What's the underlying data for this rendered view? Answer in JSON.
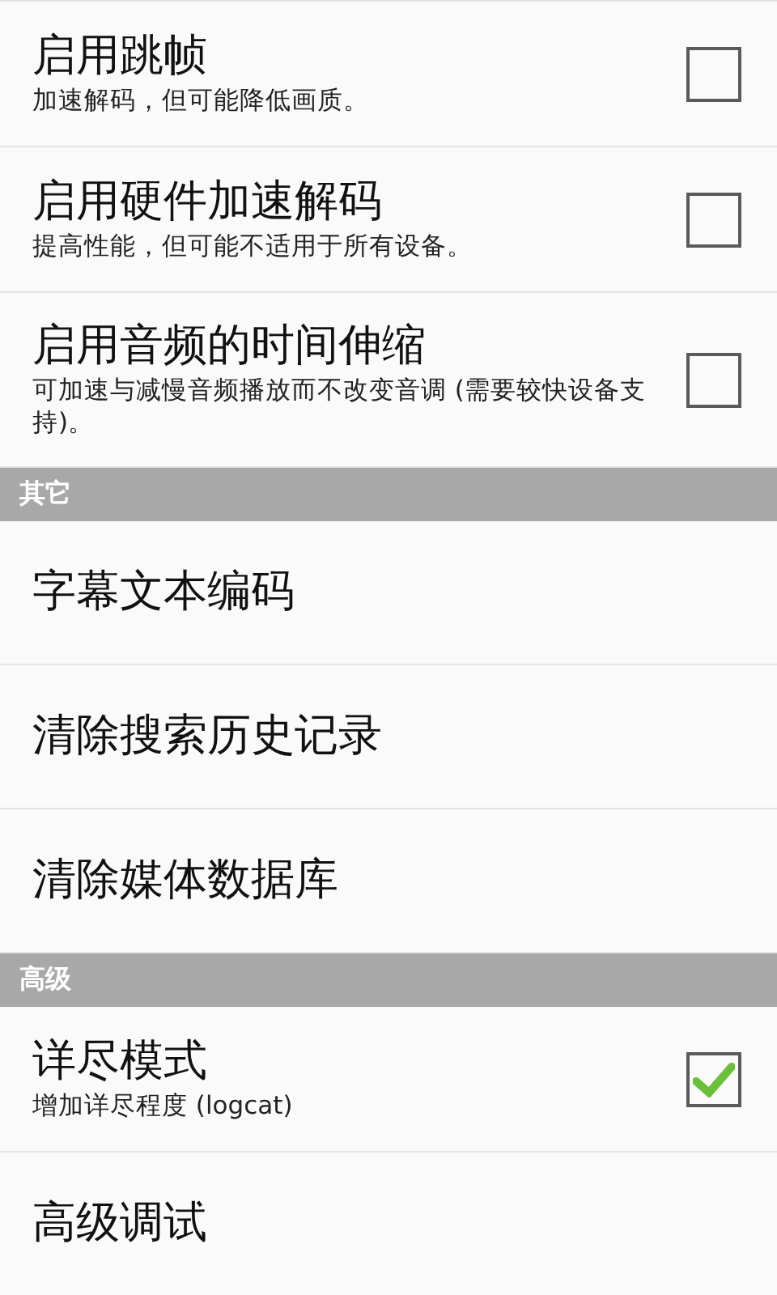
{
  "sections": [
    {
      "kind": "list",
      "items": [
        {
          "title": "启用跳帧",
          "subtitle": "加速解码，但可能降低画质。",
          "checked": false
        },
        {
          "title": "启用硬件加速解码",
          "subtitle": "提高性能，但可能不适用于所有设备。",
          "checked": false
        },
        {
          "title": "启用音频的时间伸缩",
          "subtitle": "可加速与减慢音频播放而不改变音调 (需要较快设备支持)。",
          "checked": false
        }
      ]
    },
    {
      "kind": "group",
      "header": "其它",
      "items": [
        {
          "title": "字幕文本编码"
        },
        {
          "title": "清除搜索历史记录"
        },
        {
          "title": "清除媒体数据库"
        }
      ]
    },
    {
      "kind": "group",
      "header": "高级",
      "items": [
        {
          "title": "详尽模式",
          "subtitle": "增加详尽程度 (logcat)",
          "checked": true
        },
        {
          "title": "高级调试"
        }
      ]
    }
  ]
}
